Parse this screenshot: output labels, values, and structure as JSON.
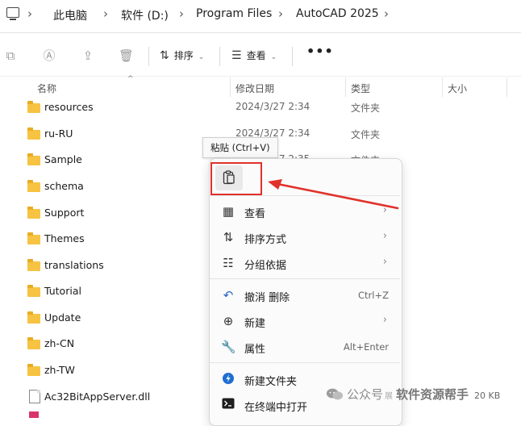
{
  "address": {
    "crumbs": [
      "此电脑",
      "软件 (D:)",
      "Program Files",
      "AutoCAD 2025"
    ]
  },
  "toolbar": {
    "sort_label": "排序",
    "view_label": "查看",
    "more_label": "•••"
  },
  "columns": {
    "name": "名称",
    "date": "修改日期",
    "type": "类型",
    "size": "大小"
  },
  "files": [
    {
      "name": "resources",
      "date": "2024/3/27 2:34",
      "type": "文件夹"
    },
    {
      "name": "ru-RU",
      "date": "2024/3/27 2:34",
      "type": "文件夹"
    },
    {
      "name": "Sample",
      "date": "2024/3/27 2:35",
      "type": "文件夹"
    },
    {
      "name": "schema",
      "date": "",
      "type": ""
    },
    {
      "name": "Support",
      "date": "",
      "type": ""
    },
    {
      "name": "Themes",
      "date": "",
      "type": ""
    },
    {
      "name": "translations",
      "date": "",
      "type": ""
    },
    {
      "name": "Tutorial",
      "date": "",
      "type": ""
    },
    {
      "name": "Update",
      "date": "",
      "type": ""
    },
    {
      "name": "zh-CN",
      "date": "",
      "type": ""
    },
    {
      "name": "zh-TW",
      "date": "",
      "type": ""
    },
    {
      "name": "Ac32BitAppServer.dll",
      "date": "",
      "type": ""
    }
  ],
  "tooltip": {
    "text": "粘贴 (Ctrl+V)"
  },
  "context_menu": {
    "items": [
      {
        "label": "查看",
        "shortcut": "",
        "submenu": true
      },
      {
        "label": "排序方式",
        "shortcut": "",
        "submenu": true
      },
      {
        "label": "分组依据",
        "shortcut": "",
        "submenu": true
      },
      {
        "label": "撤消 删除",
        "shortcut": "Ctrl+Z",
        "submenu": false
      },
      {
        "label": "新建",
        "shortcut": "",
        "submenu": true
      },
      {
        "label": "属性",
        "shortcut": "Alt+Enter",
        "submenu": false
      },
      {
        "label": "新建文件夹",
        "shortcut": "",
        "submenu": false
      },
      {
        "label": "在终端中打开",
        "shortcut": "",
        "submenu": false
      }
    ]
  },
  "watermark": {
    "label": "公众号",
    "sub": "展",
    "name": "软件资源帮手"
  },
  "size_fragment": "20 KB",
  "colors": {
    "highlight": "#e0312b",
    "folder": "#f6c342"
  }
}
